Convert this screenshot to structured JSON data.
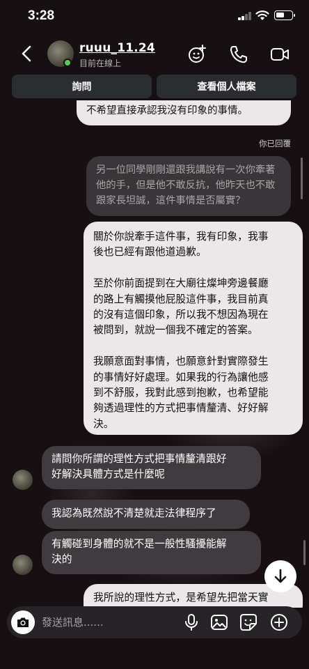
{
  "status_bar": {
    "time": "3:28",
    "battery_level": 0.55
  },
  "header": {
    "username": "ruuu_11.24",
    "presence": "目前在線上",
    "icons": [
      "back-chevron-icon",
      "add-effect-icon",
      "phone-icon",
      "video-camera-icon"
    ]
  },
  "actions": {
    "ask": "詢問",
    "view_profile": "查看個人檔案"
  },
  "messages": {
    "cut_top": "不希望直接承認我沒有印象的事情。",
    "reply_note": "你已回覆",
    "quoted": "另一位同學剛剛還跟我講說有一次你牽著\n他的手，但是他不敢反抗，他昨天也不敢\n跟家長坦誠，這件事情是否屬實？",
    "mine_long": "關於你說牽手這件事，我有印象，我事\n後也已經有跟他道過歉。\n\n至於你前面提到在大廟往燦坤旁邊餐廳\n的路上有觸摸他屁股這件事，我目前真\n的沒有這個印象，所以我不想因為現在\n被問到，就說一個我不確定的答案。\n\n我願意面對事情，也願意針對實際發生\n的事情好好處理。如果我的行為讓他感\n到不舒服，我對此感到抱歉，也希望能\n夠透過理性的方式把事情釐清、好好解\n決。",
    "theirs_1": "請問你所謂的理性方式把事情釐清跟好\n好解決具體方式是什麼呢",
    "theirs_2": "我認為既然說不清楚就走法律程序了",
    "theirs_3": "有觸碰到身體的就不是一般性騷擾能解\n決的",
    "mine_bottom": "我所說的理性方式，是希望先把當天實"
  },
  "composer": {
    "placeholder": "發送訊息......",
    "icons": [
      "camera-icon",
      "microphone-icon",
      "gallery-icon",
      "sticker-icon",
      "plus-circle-icon"
    ]
  },
  "colors": {
    "background": "#161012",
    "my_bubble": "#ece8ea",
    "their_bubble": "#403b3e",
    "button_bg": "#2b2d31",
    "online": "#5ac85a"
  }
}
